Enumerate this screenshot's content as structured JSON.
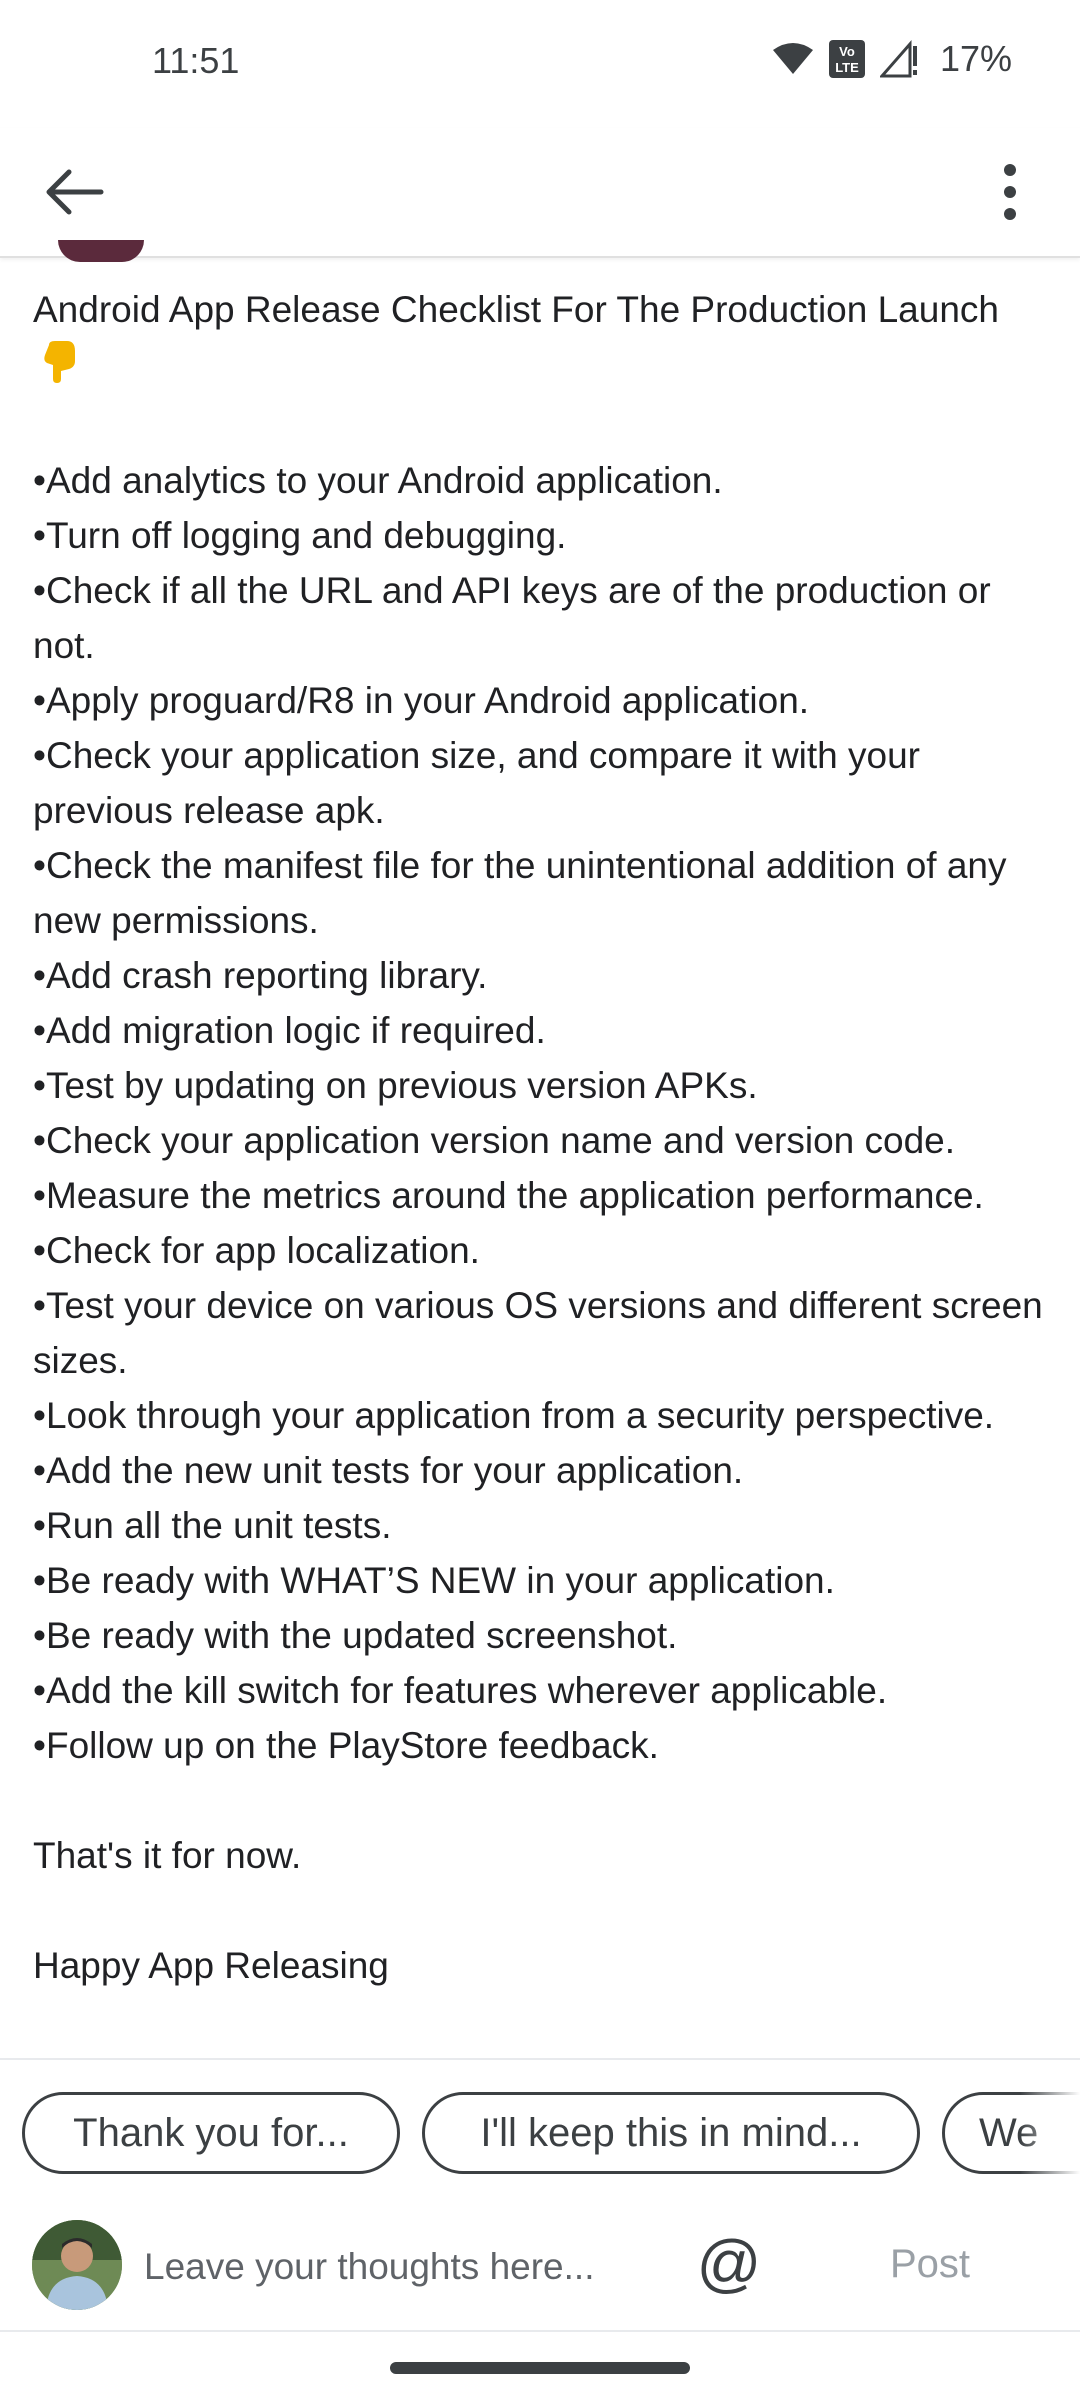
{
  "status_bar": {
    "time": "11:51",
    "battery": "17%",
    "icons": [
      "wifi-icon",
      "volte-icon",
      "signal-icon"
    ]
  },
  "app_bar": {
    "back_icon": "arrow-back-icon",
    "more_icon": "more-vert-icon"
  },
  "post": {
    "title": "Android App Release Checklist For The Production Launch",
    "title_emoji": "pointing-down-emoji",
    "bullets": [
      "Add analytics to your Android application.",
      "Turn off logging and debugging.",
      "Check if all the URL and API keys are of the production or not.",
      "Apply proguard/R8 in your Android application.",
      "Check your application size, and compare it with your previous release apk.",
      "Check the manifest file for the unintentional addition of any new permissions.",
      "Add crash reporting library.",
      "Add migration logic if required.",
      "Test by updating on previous version APKs.",
      "Check your application version name and version code.",
      "Measure the metrics around the application performance.",
      "Check for app localization.",
      "Test your device on various OS versions and different screen sizes.",
      "Look through your application from a security perspective.",
      "Add the new unit tests for your application.",
      "Run all the unit tests.",
      "Be ready with WHAT’S NEW in your application.",
      "Be ready with the updated screenshot.",
      "Add the kill switch for features wherever applicable.",
      "Follow up on the PlayStore feedback."
    ],
    "closing": "That's it for now.",
    "signoff_partial": "Happy App Releasing"
  },
  "suggestions": [
    "Thank you for...",
    "I'll keep this in mind...",
    "We"
  ],
  "compose": {
    "placeholder": "Leave your thoughts here...",
    "mention_label": "@",
    "post_label": "Post"
  },
  "colors": {
    "text": "#202124",
    "secondary": "#5f6368",
    "post_disabled": "#9aa0a6",
    "divider": "#e0e0e0"
  }
}
